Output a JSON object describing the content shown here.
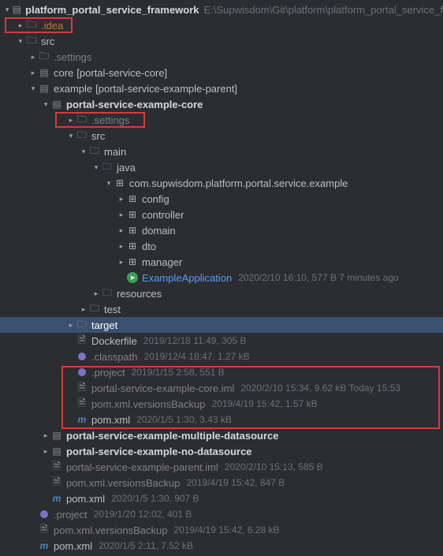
{
  "root": {
    "name": "platform_portal_service_framework",
    "path": "E:\\Supwisdom\\Git\\platform\\platform_portal_service_f"
  },
  "items": {
    "idea": ".idea",
    "src": "src",
    "settings": ".settings",
    "core": "core",
    "core_mod": "[portal-service-core]",
    "example": "example",
    "example_mod": "[portal-service-example-parent]",
    "psec": "portal-service-example-core",
    "psec_settings": ".settings",
    "psec_src": "src",
    "main": "main",
    "java": "java",
    "pkg": "com.supwisdom.platform.portal.service.example",
    "config": "config",
    "controller": "controller",
    "domain": "domain",
    "dto": "dto",
    "manager": "manager",
    "app": "ExampleApplication",
    "app_meta": "2020/2/10 16:10, 577 B 7 minutes ago",
    "resources": "resources",
    "test": "test",
    "target": "target",
    "dockerfile": "Dockerfile",
    "dockerfile_meta": "2019/12/18 11:49, 305 B",
    "classpath": ".classpath",
    "classpath_meta": "2019/12/4 18:47, 1.27 kB",
    "project": ".project",
    "project_meta": "2019/1/15 2:58, 551 B",
    "iml": "portal-service-example-core.iml",
    "iml_meta": "2020/2/10 15:34, 9.62 kB Today 15:53",
    "vb": "pom.xml.versionsBackup",
    "vb_meta": "2019/4/19 15:42, 1.57 kB",
    "pom": "pom.xml",
    "pom_meta": "2020/1/5 1:30, 3.43 kB",
    "psemd": "portal-service-example-multiple-datasource",
    "psend": "portal-service-example-no-datasource",
    "piml": "portal-service-example-parent.iml",
    "piml_meta": "2020/2/10 15:13, 585 B",
    "pvb": "pom.xml.versionsBackup",
    "pvb_meta": "2019/4/19 15:42, 847 B",
    "ppom": "pom.xml",
    "ppom_meta": "2020/1/5 1:30, 907 B",
    "rproj": ".project",
    "rproj_meta": "2019/1/20 12:02, 401 B",
    "rvb": "pom.xml.versionsBackup",
    "rvb_meta": "2019/4/19 15:42, 6.28 kB",
    "rpom": "pom.xml",
    "rpom_meta": "2020/1/5 2:11, 7.52 kB"
  }
}
